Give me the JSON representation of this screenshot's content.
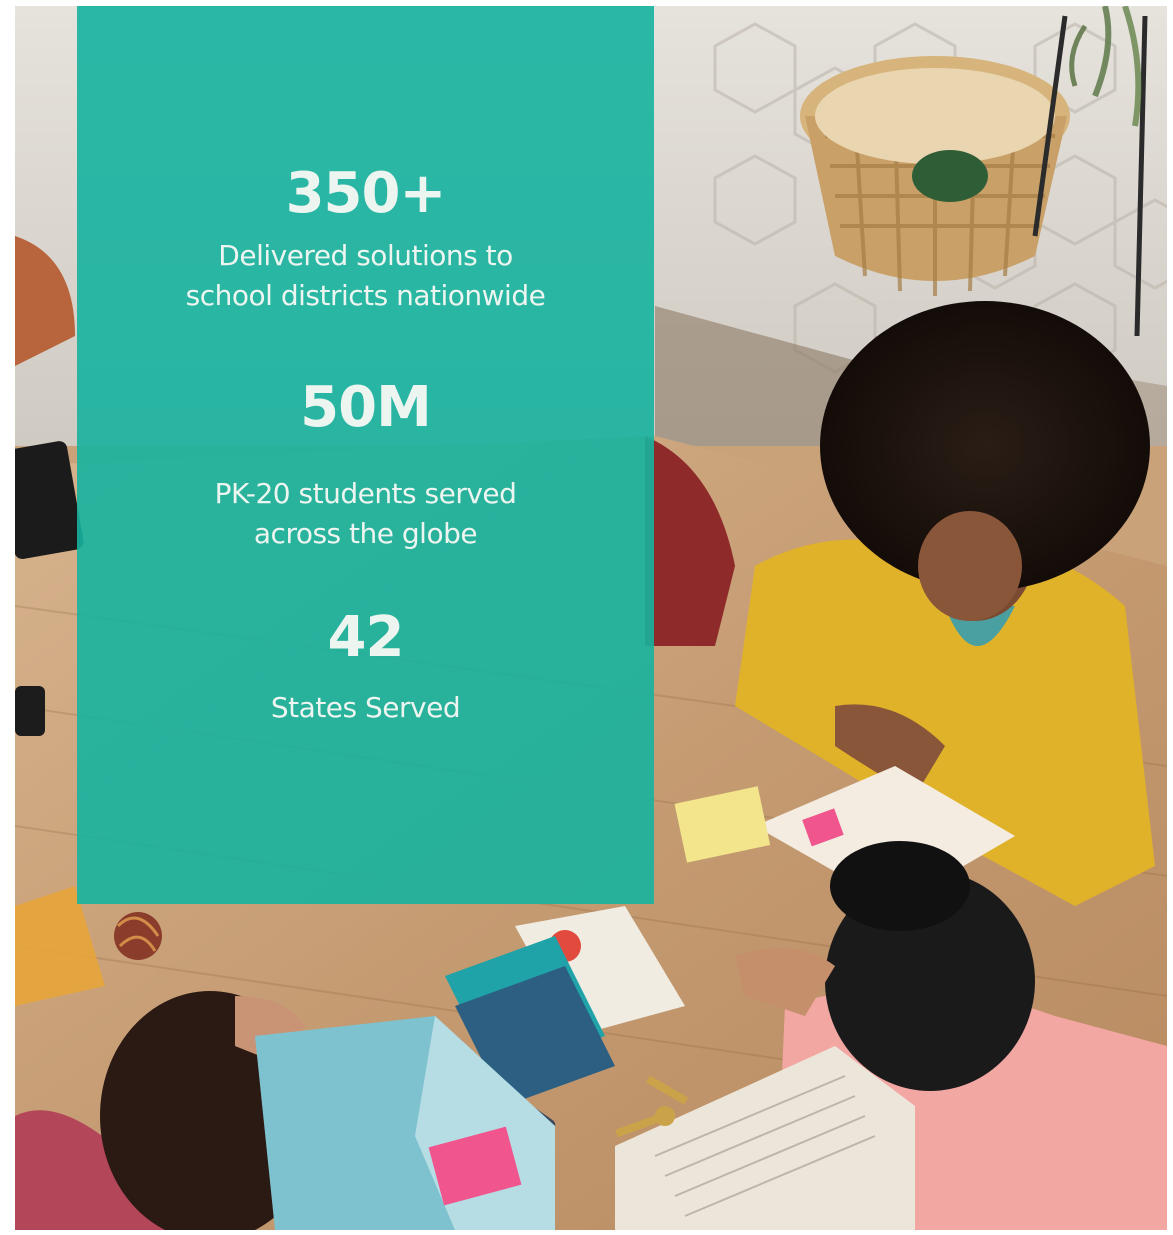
{
  "stats": [
    {
      "value": "350+",
      "label_line_1": "Delivered solutions to",
      "label_line_2": "school districts nationwide"
    },
    {
      "value": "50M",
      "label_line_1": "PK-20 students served",
      "label_line_2": "across the globe"
    },
    {
      "value": "42",
      "label_line_1": "States Served"
    }
  ],
  "colors": {
    "panel_teal": "#16B29E",
    "stat_text": "#ECF5EF",
    "table_wood": "#C9A27A",
    "yellow_cardigan": "#E0B22A",
    "teal_book": "#1FA3A8",
    "pink_shirt": "#F3A7A2",
    "sticky_note_pink": "#F0558E"
  },
  "background_photo": "classroom-students-studying-at-table"
}
